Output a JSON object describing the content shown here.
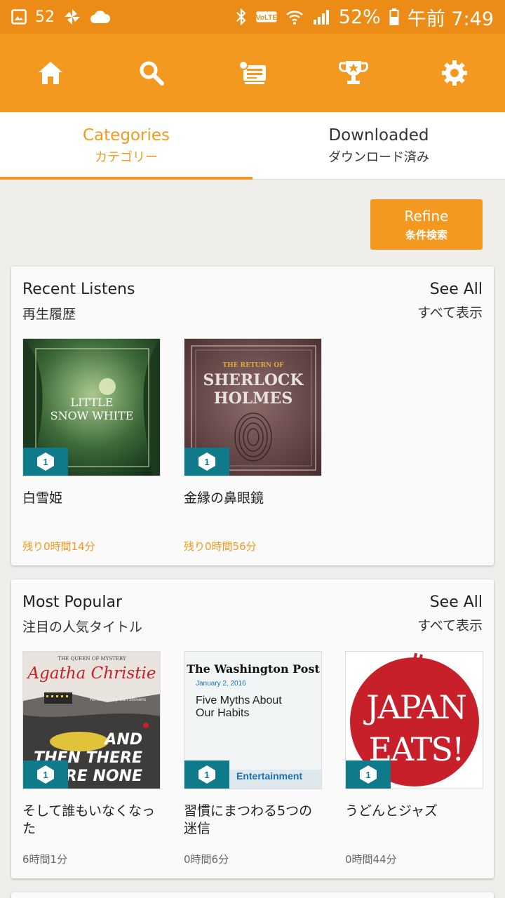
{
  "status_bar": {
    "notification_count": "52",
    "battery_percent": "52%",
    "time": "午前 7:49",
    "volte_label": "VoLTE"
  },
  "toolbar": {
    "icons": [
      "home-icon",
      "search-icon",
      "library-icon",
      "trophy-icon",
      "settings-icon"
    ]
  },
  "tabs": [
    {
      "label_en": "Categories",
      "label_ja": "カテゴリー",
      "active": true
    },
    {
      "label_en": "Downloaded",
      "label_ja": "ダウンロード済み",
      "active": false
    }
  ],
  "refine": {
    "label_en": "Refine",
    "label_ja": "条件検索"
  },
  "sections": [
    {
      "title_en": "Recent Listens",
      "title_ja": "再生履歴",
      "see_all_en": "See All",
      "see_all_ja": "すべて表示",
      "books": [
        {
          "title": "白雪姫",
          "time": "残り0時間14分",
          "badge": "1",
          "cover_text": [
            "LITTLE",
            "SNOW WHITE"
          ]
        },
        {
          "title": "金縁の鼻眼鏡",
          "time": "残り0時間56分",
          "badge": "1",
          "cover_text": [
            "THE RETURN OF",
            "SHERLOCK",
            "HOLMES"
          ]
        }
      ]
    },
    {
      "title_en": "Most Popular",
      "title_ja": "注目の人気タイトル",
      "see_all_en": "See All",
      "see_all_ja": "すべて表示",
      "books": [
        {
          "title": "そして誰もいなくなった",
          "time": "6時間1分",
          "badge": "1",
          "cover_text": [
            "THE QUEEN OF MYSTERY",
            "Agatha Christie",
            "Performed by Dan Stevens",
            "AND",
            "THEN THERE",
            "WERE NONE"
          ]
        },
        {
          "title": "習慣にまつわる5つの迷信",
          "time": "0時間6分",
          "badge": "1",
          "cover_text": [
            "The Washington Post",
            "January 2, 2016",
            "Five Myths About",
            "Our Habits",
            "Entertainment"
          ]
        },
        {
          "title": "うどんとジャズ",
          "time": "0時間44分",
          "badge": "1",
          "cover_text": [
            "JAPAN",
            "EATS!"
          ]
        }
      ]
    }
  ],
  "colors": {
    "accent": "#f4991f",
    "status_bar": "#ec8c17",
    "badge": "#0f7a8a"
  }
}
